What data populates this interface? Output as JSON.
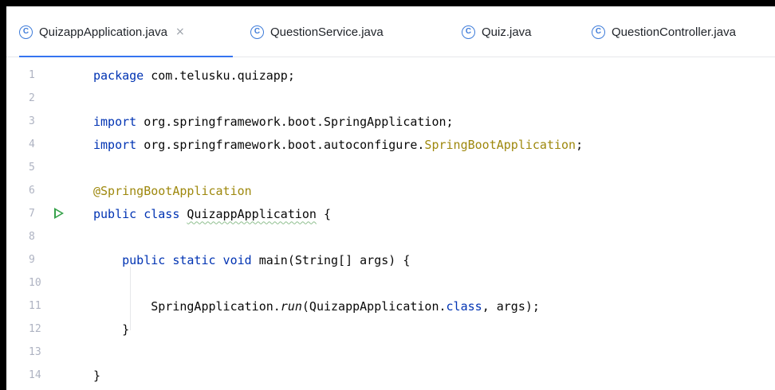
{
  "tabs": [
    {
      "label": "QuizappApplication.java",
      "icon": "class-c-icon",
      "active": true,
      "close": "×"
    },
    {
      "label": "QuestionService.java",
      "icon": "class-c-icon",
      "active": false
    },
    {
      "label": "Quiz.java",
      "icon": "class-c-icon",
      "active": false
    },
    {
      "label": "QuestionController.java",
      "icon": "class-c-icon",
      "active": false
    }
  ],
  "icon_glyph": "C",
  "colors": {
    "keyword": "#0033b3",
    "annotation": "#9e880d",
    "run_icon": "#36a24a",
    "tab_icon": "#3d7bd9",
    "active_tab_underline": "#3574f0"
  },
  "editor": {
    "line_numbers": [
      "1",
      "2",
      "3",
      "4",
      "5",
      "6",
      "7",
      "8",
      "9",
      "10",
      "11",
      "12",
      "13",
      "14"
    ],
    "lines": {
      "l1": {
        "kw": "package",
        "rest": " com.telusku.quizapp;"
      },
      "l3": {
        "kw": "import",
        "rest": " org.springframework.boot.SpringApplication;"
      },
      "l4": {
        "kw": "import",
        "rest": " org.springframework.boot.autoconfigure.",
        "ann": "SpringBootApplication",
        "end": ";"
      },
      "l6": {
        "ann": "@SpringBootApplication"
      },
      "l7": {
        "kw": "public class",
        "sp": " ",
        "name": "QuizappApplication",
        "rest": " {"
      },
      "l9": {
        "kw": "public static void",
        "rest": " main(String[] args) {"
      },
      "l11": {
        "a": "SpringApplication.",
        "method": "run",
        "b": "(QuizappApplication.",
        "kw": "class",
        "c": ", args);"
      },
      "l12": {
        "rest": "}"
      },
      "l14": {
        "rest": "}"
      }
    }
  }
}
